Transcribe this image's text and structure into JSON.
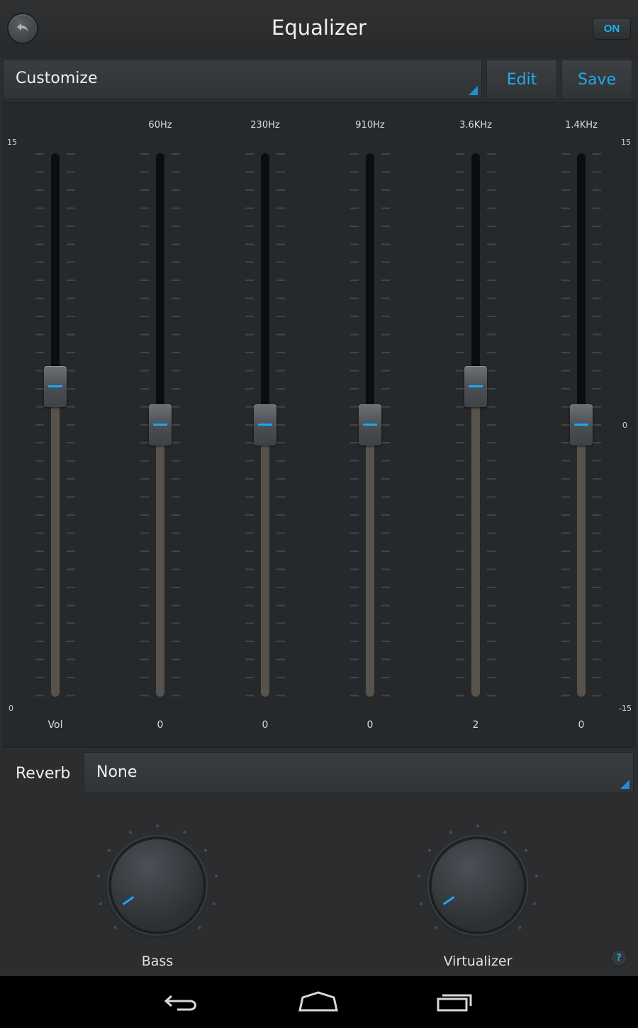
{
  "header": {
    "title": "Equalizer",
    "toggle_label": "ON"
  },
  "preset": {
    "selected": "Customize",
    "edit_label": "Edit",
    "save_label": "Save"
  },
  "scale": {
    "left_top": "15",
    "left_bottom": "0",
    "right_top": "15",
    "right_mid": "0",
    "right_bottom": "-15"
  },
  "bands": [
    {
      "freq": "",
      "value_label": "Vol",
      "level": 0.57
    },
    {
      "freq": "60Hz",
      "value_label": "0",
      "level": 0.5
    },
    {
      "freq": "230Hz",
      "value_label": "0",
      "level": 0.5
    },
    {
      "freq": "910Hz",
      "value_label": "0",
      "level": 0.5
    },
    {
      "freq": "3.6KHz",
      "value_label": "2",
      "level": 0.57
    },
    {
      "freq": "1.4KHz",
      "value_label": "0",
      "level": 0.5
    }
  ],
  "reverb": {
    "label": "Reverb",
    "selected": "None"
  },
  "knobs": {
    "bass_label": "Bass",
    "virtualizer_label": "Virtualizer"
  },
  "colors": {
    "accent": "#1aa8f0",
    "background": "#2b2d2f",
    "navbar": "#000000"
  },
  "icons": {
    "back": "back-arrow-icon",
    "help": "help-icon",
    "nav_back": "nav-back-icon",
    "nav_home": "nav-home-icon",
    "nav_recents": "nav-recents-icon"
  },
  "help_label": "?"
}
